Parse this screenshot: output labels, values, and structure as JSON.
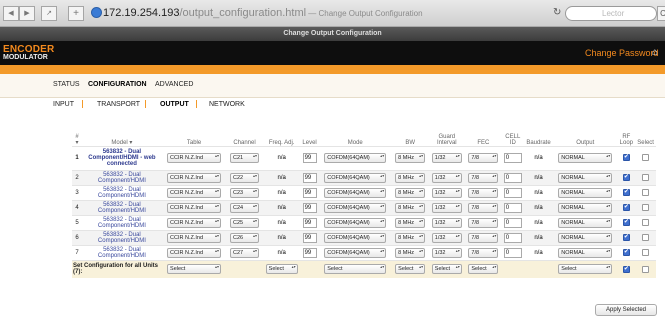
{
  "browser": {
    "url_host": "172.19.254.193",
    "url_path": "/output_configuration.html",
    "url_title": " — Change Output Configuration",
    "search_placeholder": "Lector"
  },
  "window_title": "Change Output Configuration",
  "header": {
    "logo_top": "ENCODER",
    "logo_bottom": "MODULATOR",
    "change_password": "Change Password"
  },
  "main_nav": [
    "STATUS",
    "CONFIGURATION",
    "ADVANCED"
  ],
  "sub_nav": [
    "INPUT",
    "TRANSPORT",
    "OUTPUT",
    "NETWORK"
  ],
  "table": {
    "headers": [
      "#",
      "Model",
      "Table",
      "Channel",
      "Freq. Adj.",
      "Level",
      "Mode",
      "BW",
      "Guard Interval",
      "FEC",
      "CELL ID",
      "Baudrate",
      "Output",
      "RF Loop",
      "Select"
    ],
    "rows": [
      {
        "num": "1",
        "model": "563832 - Dual Component/HDMI - web connected",
        "table": "CCIR N.Z.Ind",
        "channel": "C21",
        "freq": "n/a",
        "level": "99",
        "mode": "COFDM(64QAM)",
        "bw": "8 MHz",
        "guard": "1/32",
        "fec": "7/8",
        "cell": "0",
        "baud": "n/a",
        "output": "NORMAL"
      },
      {
        "num": "2",
        "model": "563832 - Dual Component/HDMI",
        "table": "CCIR N.Z.Ind",
        "channel": "C22",
        "freq": "n/a",
        "level": "99",
        "mode": "COFDM(64QAM)",
        "bw": "8 MHz",
        "guard": "1/32",
        "fec": "7/8",
        "cell": "0",
        "baud": "n/a",
        "output": "NORMAL"
      },
      {
        "num": "3",
        "model": "563832 - Dual Component/HDMI",
        "table": "CCIR N.Z.Ind",
        "channel": "C23",
        "freq": "n/a",
        "level": "99",
        "mode": "COFDM(64QAM)",
        "bw": "8 MHz",
        "guard": "1/32",
        "fec": "7/8",
        "cell": "0",
        "baud": "n/a",
        "output": "NORMAL"
      },
      {
        "num": "4",
        "model": "563832 - Dual Component/HDMI",
        "table": "CCIR N.Z.Ind",
        "channel": "C24",
        "freq": "n/a",
        "level": "99",
        "mode": "COFDM(64QAM)",
        "bw": "8 MHz",
        "guard": "1/32",
        "fec": "7/8",
        "cell": "0",
        "baud": "n/a",
        "output": "NORMAL"
      },
      {
        "num": "5",
        "model": "563832 - Dual Component/HDMI",
        "table": "CCIR N.Z.Ind",
        "channel": "C25",
        "freq": "n/a",
        "level": "99",
        "mode": "COFDM(64QAM)",
        "bw": "8 MHz",
        "guard": "1/32",
        "fec": "7/8",
        "cell": "0",
        "baud": "n/a",
        "output": "NORMAL"
      },
      {
        "num": "6",
        "model": "563832 - Dual Component/HDMI",
        "table": "CCIR N.Z.Ind",
        "channel": "C26",
        "freq": "n/a",
        "level": "99",
        "mode": "COFDM(64QAM)",
        "bw": "8 MHz",
        "guard": "1/32",
        "fec": "7/8",
        "cell": "0",
        "baud": "n/a",
        "output": "NORMAL"
      },
      {
        "num": "7",
        "model": "563832 - Dual Component/HDMI",
        "table": "CCIR N.Z.Ind",
        "channel": "C27",
        "freq": "n/a",
        "level": "99",
        "mode": "COFDM(64QAM)",
        "bw": "8 MHz",
        "guard": "1/32",
        "fec": "7/8",
        "cell": "0",
        "baud": "n/a",
        "output": "NORMAL"
      }
    ],
    "set_all_label": "Set Configuration for all Units (7):",
    "select_label": "Select"
  },
  "apply_button": "Apply Selected"
}
